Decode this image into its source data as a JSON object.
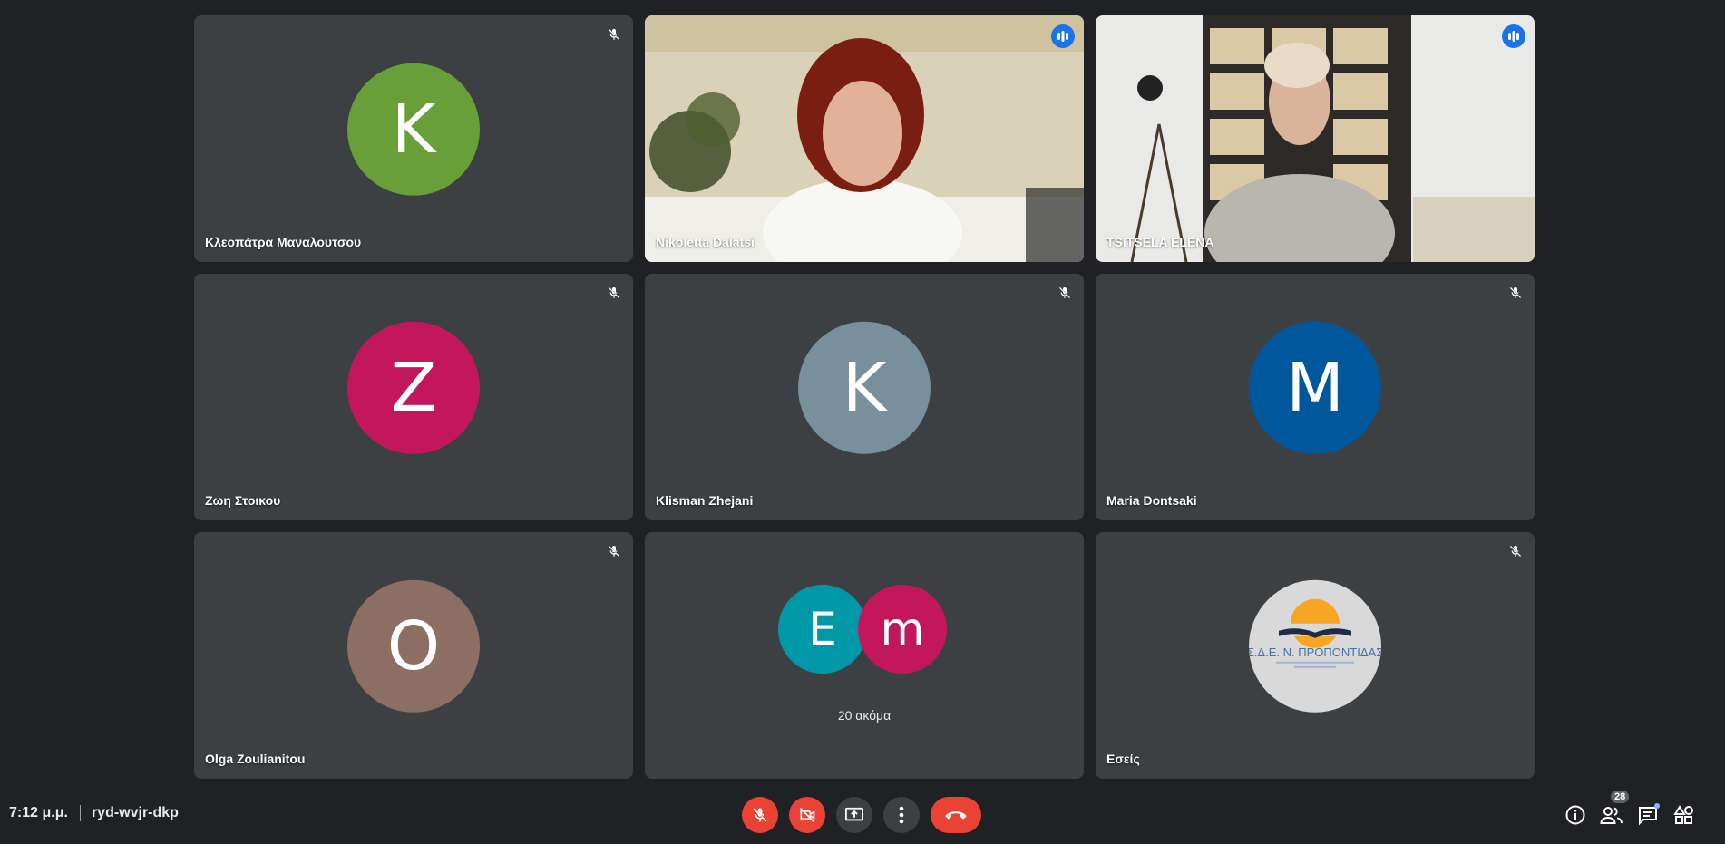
{
  "tiles": [
    {
      "name": "Κλεοπάτρα Μαναλουτσου",
      "initial": "K",
      "color": "#689f38",
      "muted": true
    },
    {
      "name": "Nikoletta Dalatsi",
      "speaking": true
    },
    {
      "name": "TSITSELA ELENA",
      "speaking": true
    },
    {
      "name": "Ζωη Στοικου",
      "initial": "Z",
      "color": "#c2185b",
      "muted": true
    },
    {
      "name": "Klisman Zhejani",
      "initial": "K",
      "color": "#78909c",
      "muted": true
    },
    {
      "name": "Maria Dontsaki",
      "initial": "M",
      "color": "#01579b",
      "muted": true
    },
    {
      "name": "Olga Zoulianitou",
      "initial": "O",
      "color": "#8d6e63",
      "muted": true
    },
    {
      "more_label": "20 ακόμα",
      "avatars": [
        {
          "initial": "E",
          "color": "#0097a7"
        },
        {
          "initial": "m",
          "color": "#c2185b"
        }
      ]
    },
    {
      "name": "Εσείς",
      "logo_text": "Σ.Δ.Ε. Ν. ΠΡΟΠΟΝΤΙΔΑΣ",
      "muted": true
    }
  ],
  "meeting": {
    "time": "7:12 μ.μ.",
    "code": "ryd-wvjr-dkp"
  },
  "controls": {
    "mic": "mic-off-icon",
    "camera": "camera-off-icon",
    "present": "present-icon",
    "more": "more-vert-icon",
    "leave": "call-end-icon"
  },
  "side": {
    "participants_count": "28"
  },
  "colors": {
    "background": "#202124",
    "tile": "#3c4043",
    "danger": "#ea4335",
    "accent": "#8ab4f8"
  }
}
